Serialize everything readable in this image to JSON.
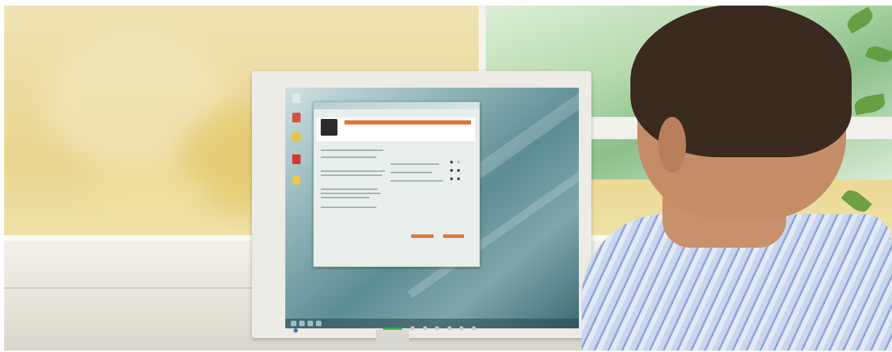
{
  "scene": {
    "description_tag": "photo",
    "colors": {
      "wall": "#ead68f",
      "accent_orange": "#e2743a",
      "screen": "#5d8d94",
      "shirt_stripe": "#8fa6d8"
    }
  },
  "monitor": {
    "dialog": {
      "title_text": "",
      "banner_color": "#e2743a"
    },
    "icons": [
      "recycle-bin-icon",
      "user-icon",
      "folder-icon",
      "app-icon",
      "settings-icon"
    ]
  }
}
